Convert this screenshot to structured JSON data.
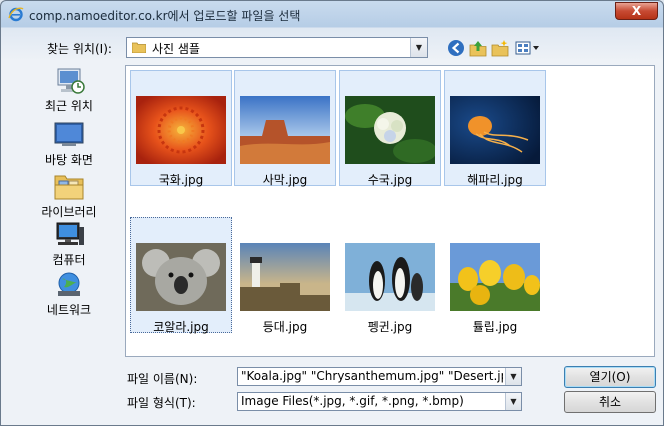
{
  "window": {
    "title": "comp.namoeditor.co.kr에서 업로드할 파일을 선택",
    "close_label": "X"
  },
  "lookin": {
    "label": "찾는 위치(I):",
    "value": "사진 샘플"
  },
  "toolbar": {
    "icons": [
      "back-icon",
      "up-folder-icon",
      "new-folder-icon",
      "view-menu-icon"
    ]
  },
  "places": [
    {
      "label": "최근 위치",
      "icon": "recent-places-icon"
    },
    {
      "label": "바탕 화면",
      "icon": "desktop-icon"
    },
    {
      "label": "라이브러리",
      "icon": "libraries-icon"
    },
    {
      "label": "컴퓨터",
      "icon": "computer-icon"
    },
    {
      "label": "네트워크",
      "icon": "network-icon"
    }
  ],
  "files": [
    {
      "name": "국화.jpg",
      "selected": true
    },
    {
      "name": "사막.jpg",
      "selected": true
    },
    {
      "name": "수국.jpg",
      "selected": true
    },
    {
      "name": "해파리.jpg",
      "selected": true
    },
    {
      "name": "코알라.jpg",
      "selected": true,
      "focused": true
    },
    {
      "name": "등대.jpg",
      "selected": false
    },
    {
      "name": "펭귄.jpg",
      "selected": false
    },
    {
      "name": "튤립.jpg",
      "selected": false
    }
  ],
  "filename": {
    "label": "파일 이름(N):",
    "value": "\"Koala.jpg\" \"Chrysanthemum.jpg\" \"Desert.jpg\" \""
  },
  "filetype": {
    "label": "파일 형식(T):",
    "value": "Image Files(*.jpg, *.gif, *.png, *.bmp)"
  },
  "buttons": {
    "open": "열기(O)",
    "cancel": "취소"
  }
}
